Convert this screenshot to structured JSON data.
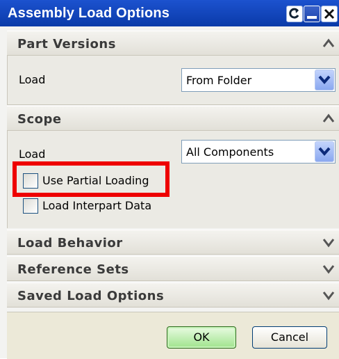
{
  "window": {
    "title": "Assembly Load Options",
    "controls": [
      "refresh-icon",
      "minimize-icon",
      "close-icon"
    ]
  },
  "sections": {
    "part_versions": {
      "title": "Part Versions",
      "expanded": true,
      "load_label": "Load",
      "load_value": "From Folder"
    },
    "scope": {
      "title": "Scope",
      "expanded": true,
      "load_label": "Load",
      "load_value": "All Components",
      "use_partial_loading": {
        "label": "Use Partial Loading",
        "checked": false
      },
      "load_interpart_data": {
        "label": "Load Interpart Data",
        "checked": false
      }
    },
    "load_behavior": {
      "title": "Load Behavior",
      "expanded": false
    },
    "reference_sets": {
      "title": "Reference Sets",
      "expanded": false
    },
    "saved_load_options": {
      "title": "Saved Load Options",
      "expanded": false
    }
  },
  "buttons": {
    "ok": "OK",
    "cancel": "Cancel"
  },
  "colors": {
    "titlebar": "#0a3aa8",
    "highlight": "#ee0000",
    "ok_button": "#9fe38c"
  }
}
